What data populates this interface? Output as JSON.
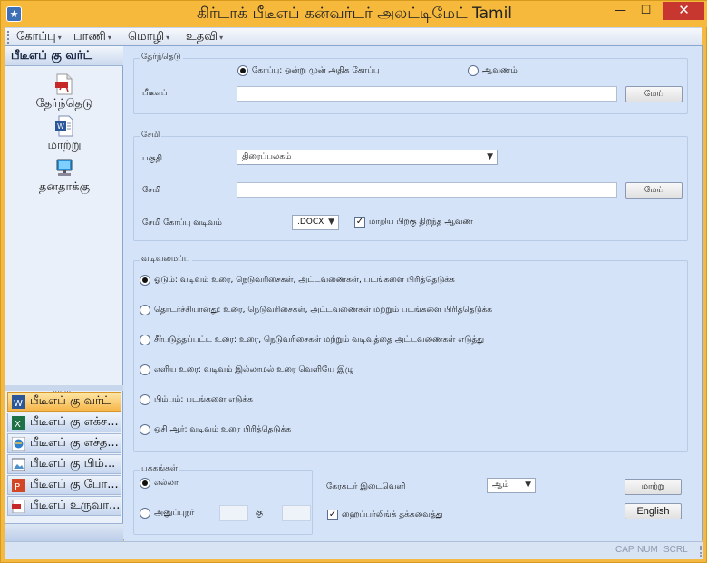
{
  "window": {
    "title": "கிர்டாக் பீடீஎப் கன்வர்டர் அலட்டிமேட் Tamil",
    "minimize": "—",
    "maximize": "☐",
    "close": "✕",
    "app_icon": "star-icon"
  },
  "menu": [
    {
      "label": "கோப்பு",
      "arrow": "▾"
    },
    {
      "label": "பாணி",
      "arrow": "▾"
    },
    {
      "label": "மொழி",
      "arrow": "▾"
    },
    {
      "label": "உதவி",
      "arrow": "▾"
    }
  ],
  "sidebar": {
    "header": "பீடீஎப் கு வர்ட்",
    "tools": [
      {
        "label": "தேர்ந்தெடு",
        "icon": "pdf-file-icon"
      },
      {
        "label": "மாற்று",
        "icon": "word-document-icon"
      },
      {
        "label": "தனதாக்கு",
        "icon": "computer-icon"
      }
    ],
    "splitter": "........",
    "nav": [
      {
        "label": "பீடீஎப் கு வர்ட்",
        "icon": "word-icon",
        "active": true
      },
      {
        "label": "பீடீஎப் கு எக்ச...",
        "icon": "excel-icon",
        "active": false
      },
      {
        "label": "பீடீஎப் கு எச்த...",
        "icon": "html-icon",
        "active": false
      },
      {
        "label": "பீடீஎப் கு பிம்...",
        "icon": "image-icon",
        "active": false
      },
      {
        "label": "பீடீஎப் கு போ...",
        "icon": "powerpoint-icon",
        "active": false
      },
      {
        "label": "பீடீஎப் உருவா...",
        "icon": "pdf-create-icon",
        "active": false
      }
    ]
  },
  "select_group": {
    "title": "தேர்ந்தெடு",
    "radio_file": "கோப்பு: ஒன்று முன் அதிக கோப்பு",
    "radio_folder": "ஆவணம்",
    "field_label": "பீடீஎப்",
    "field_value": "",
    "browse": "மேய்"
  },
  "save_group": {
    "title": "சேமி",
    "mode_label": "பகுதி",
    "mode_value": "திரைப்பலகம்",
    "save_label": "சேமி",
    "save_value": "",
    "browse": "மேய்",
    "format_label": "சேமி கோப்பு வடிவம்",
    "format_value": ".DOCX",
    "open_after": "மாறிய பிறகு திறந்த ஆவண",
    "open_after_checked": true
  },
  "layout_group": {
    "title": "வடிவமைப்பு",
    "options": [
      {
        "text": "ஓடும்: வடிவம் உரை, நெடுவரிசைகள், அட்டவணைகள், படங்களை பிரித்தெடுக்க",
        "selected": true
      },
      {
        "text": "தொடர்ச்சியானது: உரை, நெடுவரிசைகள், அட்டவணைகள் மற்றும் படங்களை பிரித்தெடுக்க",
        "selected": false
      },
      {
        "text": "சீர்படுத்தப்பட்ட உரை: உரை, நெடுவரிசைகள் மற்றும் வடிவத்தை அட்டவணைகள் எடுத்து",
        "selected": false
      },
      {
        "text": "எளிய உரை: வடிவம் இல்லாமல் உரை வெளியே இழு",
        "selected": false
      },
      {
        "text": "பிம்பம்: படங்களை எடுக்க",
        "selected": false
      },
      {
        "text": "ஓசி ஆர்: வடிவம் உரை பிரித்தெடுக்க",
        "selected": false
      }
    ]
  },
  "pages_group": {
    "title": "பக்கங்கள்",
    "all": "எல்லா",
    "range": "அனுப்புநர்",
    "to": "கு",
    "from_value": "",
    "to_value": ""
  },
  "options": {
    "spacing_label": "கேரக்டர் இடைவெளி",
    "spacing_value": "ஆம்",
    "hyperlink_label": "ஹைப்பர்லிங்க் தக்கவைத்து",
    "hyperlink_checked": true,
    "convert": "மாற்று",
    "english": "English"
  },
  "status": {
    "cap": "CAP",
    "num": "NUM",
    "scrl": "SCRL"
  },
  "colors": {
    "title_bar": "#f6b93b",
    "close": "#c7372f",
    "client": "#d4e3f8",
    "active_nav": "#f7b64a"
  }
}
